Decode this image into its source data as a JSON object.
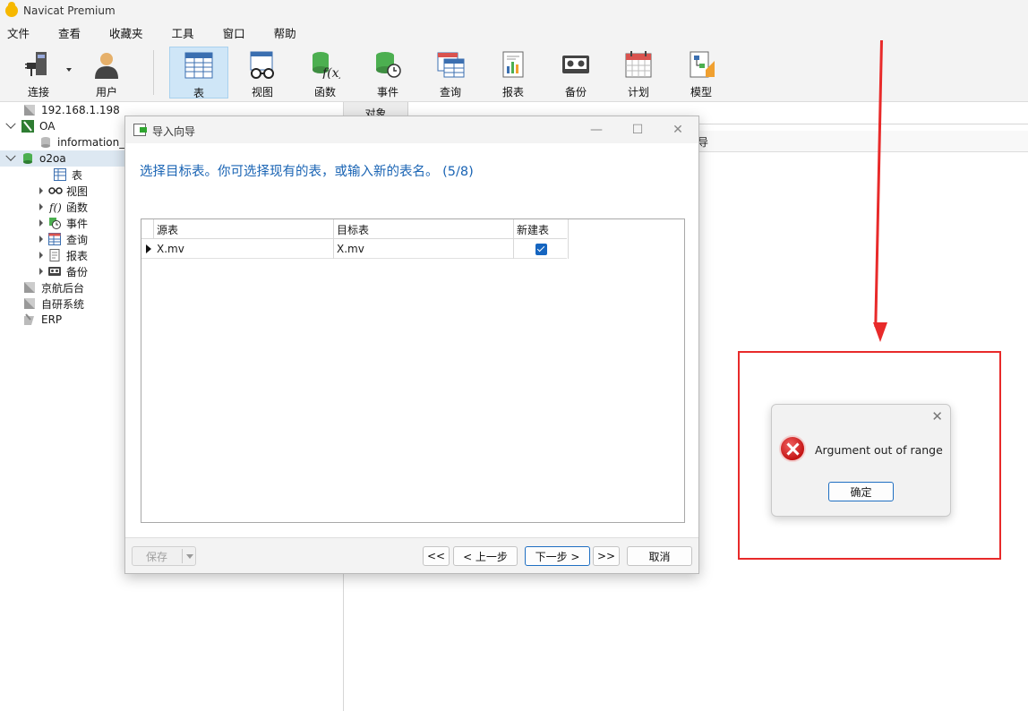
{
  "app": {
    "title": "Navicat Premium"
  },
  "menu": [
    "文件",
    "查看",
    "收藏夹",
    "工具",
    "窗口",
    "帮助"
  ],
  "toolbar": {
    "connect": "连接",
    "user": "用户",
    "table": "表",
    "view": "视图",
    "function": "函数",
    "event": "事件",
    "query": "查询",
    "report": "报表",
    "backup": "备份",
    "schedule": "计划",
    "model": "模型"
  },
  "tree": {
    "conn1": "192.168.1.198",
    "conn2": "OA",
    "db1": "information_s",
    "db2": "o2oa",
    "items": [
      "表",
      "视图",
      "函数",
      "事件",
      "查询",
      "报表",
      "备份"
    ],
    "conn3": "京航后台",
    "conn4": "自研系统",
    "conn5": "ERP"
  },
  "main": {
    "tab": "对象",
    "behind_text": "导"
  },
  "wizard": {
    "title": "导入向导",
    "heading": "选择目标表。你可选择现有的表，或输入新的表名。 (5/8)",
    "columns": [
      "源表",
      "目标表",
      "新建表"
    ],
    "rows": [
      {
        "source": "X.mv",
        "target": "X.mv",
        "new_table": true
      }
    ],
    "save": "保存",
    "first": "<<",
    "prev": "< 上一步",
    "next": "下一步 >",
    "last": ">>",
    "cancel": "取消"
  },
  "error": {
    "message": "Argument out of range",
    "ok": "确定"
  },
  "annotation": {
    "color": "#e82a2a"
  }
}
